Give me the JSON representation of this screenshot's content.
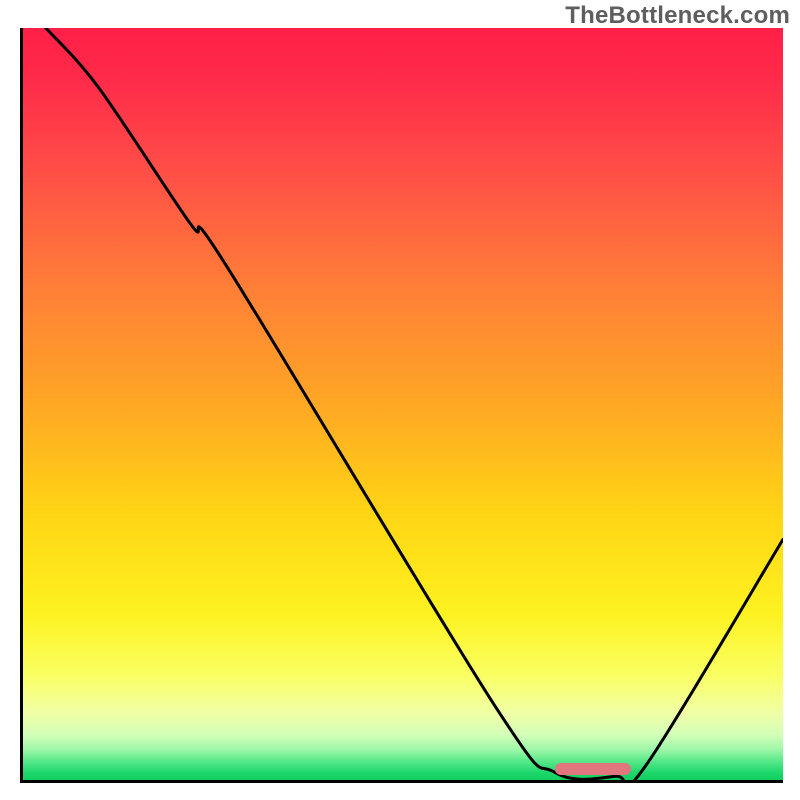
{
  "watermark": "TheBottleneck.com",
  "chart_data": {
    "type": "line",
    "title": "",
    "xlabel": "",
    "ylabel": "",
    "xlim": [
      0,
      100
    ],
    "ylim": [
      0,
      100
    ],
    "grid": false,
    "legend": false,
    "series": [
      {
        "name": "bottleneck-curve",
        "x": [
          3,
          10,
          22,
          27,
          62,
          70,
          78,
          82,
          100
        ],
        "y": [
          100,
          92,
          74,
          68,
          10,
          1,
          0.5,
          2,
          32
        ]
      }
    ],
    "optimal_marker": {
      "x_start": 70,
      "x_end": 80,
      "y": 1.5
    },
    "background_gradient": {
      "stops": [
        {
          "offset": 0.0,
          "color": "#ff1f47"
        },
        {
          "offset": 0.07,
          "color": "#ff2b4a"
        },
        {
          "offset": 0.2,
          "color": "#ff5146"
        },
        {
          "offset": 0.35,
          "color": "#ff8037"
        },
        {
          "offset": 0.5,
          "color": "#ffa724"
        },
        {
          "offset": 0.65,
          "color": "#ffd614"
        },
        {
          "offset": 0.78,
          "color": "#fdf221"
        },
        {
          "offset": 0.86,
          "color": "#faff62"
        },
        {
          "offset": 0.91,
          "color": "#f1ffa6"
        },
        {
          "offset": 0.94,
          "color": "#d3ffb8"
        },
        {
          "offset": 0.96,
          "color": "#9cf7a7"
        },
        {
          "offset": 0.975,
          "color": "#58e889"
        },
        {
          "offset": 0.99,
          "color": "#1ed86c"
        },
        {
          "offset": 1.0,
          "color": "#10cf5f"
        }
      ]
    }
  }
}
